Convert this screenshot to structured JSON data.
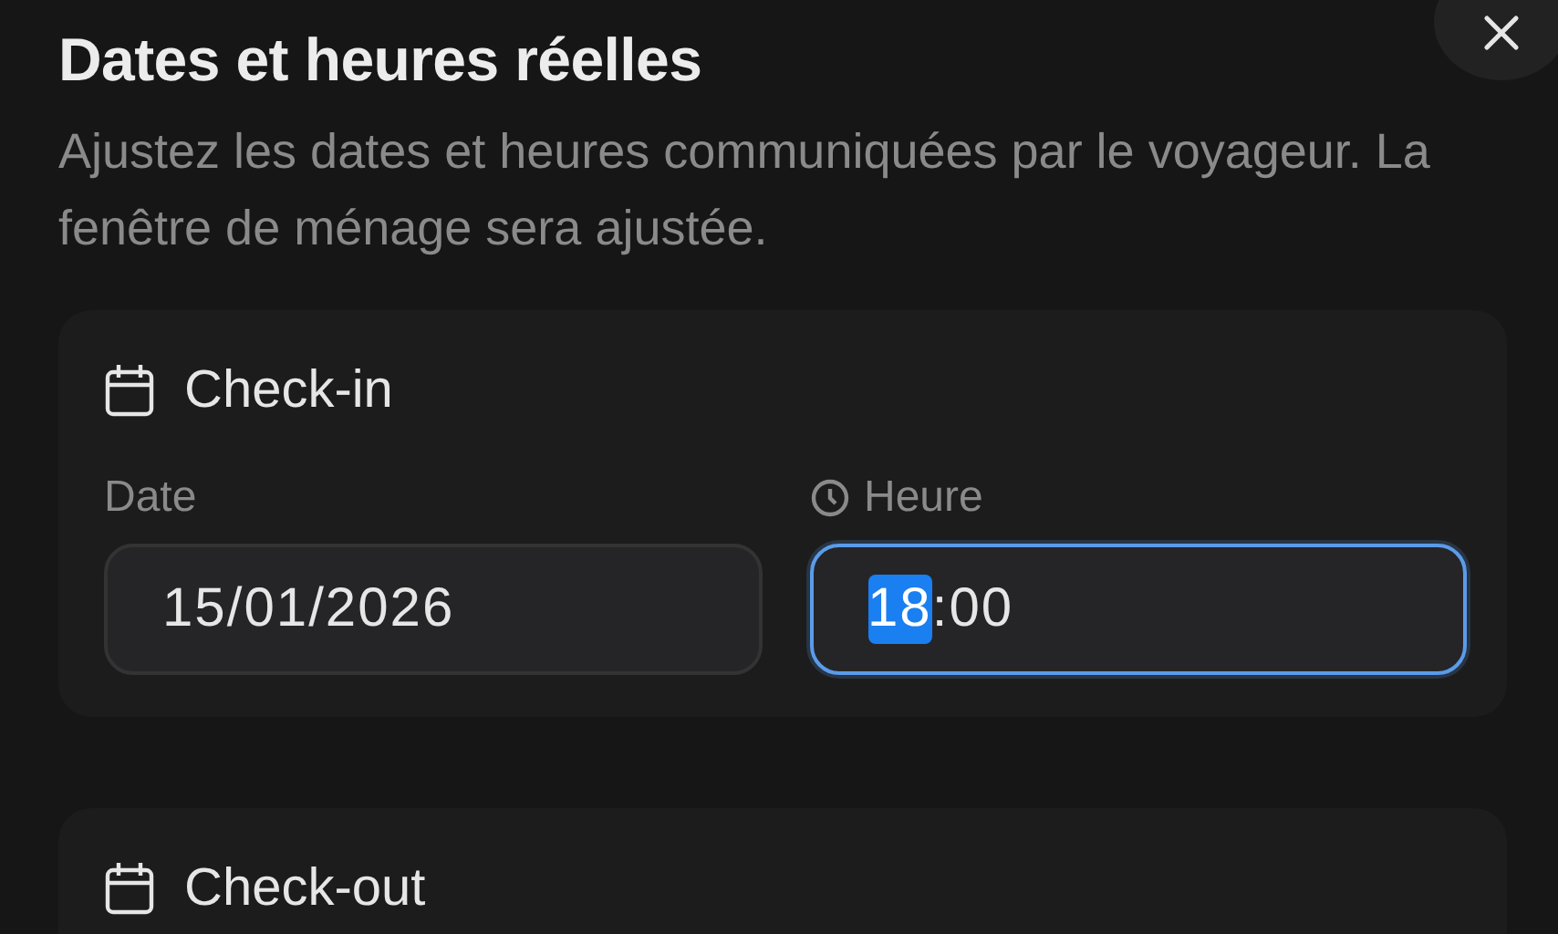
{
  "dialog": {
    "title": "Dates et heures réelles",
    "description": "Ajustez les dates et heures communiquées par le voyageur. La fenêtre de ménage sera ajustée."
  },
  "sections": [
    {
      "heading": "Check-in",
      "fields": [
        {
          "label": "Date",
          "kind": "date",
          "focused": false,
          "segments": [
            {
              "text": "15/01/2026",
              "selected": false
            }
          ]
        },
        {
          "label": "Heure",
          "kind": "time",
          "focused": true,
          "segments": [
            {
              "text": "18",
              "selected": true
            },
            {
              "text": ":00",
              "selected": false
            }
          ]
        }
      ]
    },
    {
      "heading": "Check-out"
    }
  ]
}
